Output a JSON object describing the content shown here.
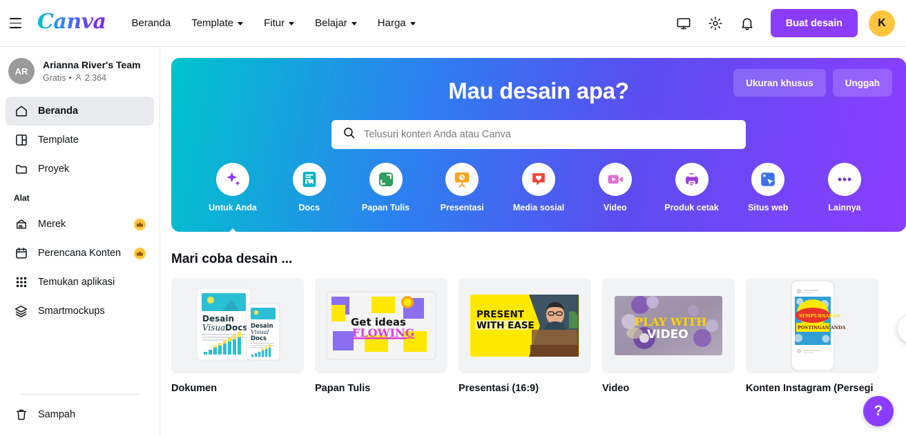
{
  "header": {
    "menu_icon": "hamburger-icon",
    "brand": "Canva",
    "nav": [
      {
        "label": "Beranda",
        "has_chevron": false
      },
      {
        "label": "Template",
        "has_chevron": true
      },
      {
        "label": "Fitur",
        "has_chevron": true
      },
      {
        "label": "Belajar",
        "has_chevron": true
      },
      {
        "label": "Harga",
        "has_chevron": true
      }
    ],
    "icons": [
      "monitor-icon",
      "gear-icon",
      "bell-icon"
    ],
    "create_button": "Buat desain",
    "avatar_initial": "K",
    "accent_purple": "#8b3dff",
    "avatar_color": "#ffc53d"
  },
  "sidebar": {
    "team": {
      "initials": "AR",
      "name": "Arianna River's Team",
      "plan": "Gratis",
      "separator": "•",
      "members": "2.364"
    },
    "items": [
      {
        "label": "Beranda",
        "icon": "home-icon",
        "active": true,
        "pro": false
      },
      {
        "label": "Template",
        "icon": "template-icon",
        "active": false,
        "pro": false
      },
      {
        "label": "Proyek",
        "icon": "folder-icon",
        "active": false,
        "pro": false
      }
    ],
    "tools_label": "Alat",
    "tools": [
      {
        "label": "Merek",
        "icon": "brand-icon",
        "pro": true
      },
      {
        "label": "Perencana Konten",
        "icon": "calendar-icon",
        "pro": true
      },
      {
        "label": "Temukan aplikasi",
        "icon": "apps-grid-icon",
        "pro": false
      },
      {
        "label": "Smartmockups",
        "icon": "layers-icon",
        "pro": false
      }
    ],
    "trash": {
      "label": "Sampah",
      "icon": "trash-icon"
    }
  },
  "hero": {
    "title": "Mau desain apa?",
    "custom_size_button": "Ukuran khusus",
    "upload_button": "Unggah",
    "search": {
      "placeholder": "Telusuri konten Anda atau Canva",
      "value": "",
      "icon": "search-icon"
    },
    "categories": [
      {
        "label": "Untuk Anda",
        "icon": "sparkles-icon",
        "color": "#8b3dff",
        "active": true
      },
      {
        "label": "Docs",
        "icon": "docs-icon",
        "color": "#00b3c8",
        "active": false
      },
      {
        "label": "Papan Tulis",
        "icon": "whiteboard-icon",
        "color": "#2d9e5f",
        "active": false
      },
      {
        "label": "Presentasi",
        "icon": "presentation-icon",
        "color": "#f5a623",
        "active": false
      },
      {
        "label": "Media sosial",
        "icon": "heart-chat-icon",
        "color": "#f0443a",
        "active": false
      },
      {
        "label": "Video",
        "icon": "video-camera-icon",
        "color": "#df6fd4",
        "active": false
      },
      {
        "label": "Produk cetak",
        "icon": "printer-icon",
        "color": "#9b3ce0",
        "active": false
      },
      {
        "label": "Situs web",
        "icon": "website-cursor-icon",
        "color": "#3a72e8",
        "active": false
      },
      {
        "label": "Lainnya",
        "icon": "more-dots-icon",
        "color": "#6e3cc4",
        "active": false
      }
    ]
  },
  "section": {
    "title": "Mari coba desain ...",
    "next_arrow_icon": "chevron-right-icon",
    "cards": [
      {
        "label": "Dokumen",
        "thumb_type": "document",
        "thumb_text": {
          "line1": "Desain",
          "line2": "Visual",
          "line3": "Docs"
        }
      },
      {
        "label": "Papan Tulis",
        "thumb_type": "whiteboard",
        "thumb_text": {
          "line1": "Get ideas",
          "line2": "FLOWING"
        }
      },
      {
        "label": "Presentasi (16:9)",
        "thumb_type": "presentation",
        "thumb_text": {
          "line1": "PRESENT",
          "line2": "WITH EASE"
        }
      },
      {
        "label": "Video",
        "thumb_type": "video",
        "thumb_text": {
          "line1": "PLAY WITH",
          "line2": "VIDEO"
        }
      },
      {
        "label": "Konten Instagram (Persegi",
        "thumb_type": "instagram",
        "thumb_text": {
          "line1": "SEMPURNAKAN",
          "line2": "POSTINGAN ANDA"
        }
      }
    ]
  },
  "help": {
    "label": "?",
    "icon": "question-mark-icon"
  }
}
